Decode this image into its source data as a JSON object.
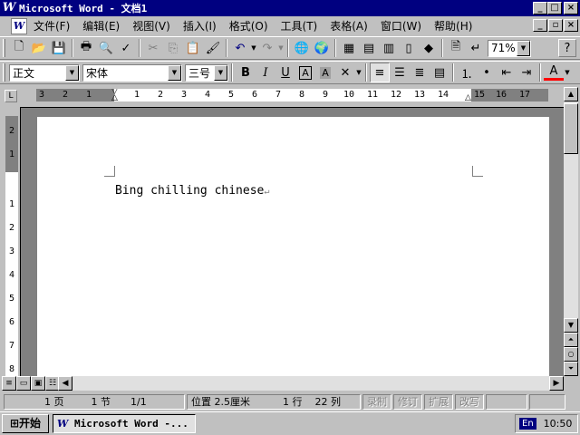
{
  "window": {
    "title": "Microsoft Word - 文档1",
    "app_icon": "W",
    "controls": [
      "_",
      "□",
      "×"
    ]
  },
  "menu": {
    "items": [
      "文件(F)",
      "编辑(E)",
      "视图(V)",
      "插入(I)",
      "格式(O)",
      "工具(T)",
      "表格(A)",
      "窗口(W)",
      "帮助(H)"
    ],
    "doc_controls": [
      "_",
      "▫",
      "×"
    ]
  },
  "standard_toolbar": {
    "zoom": "71%",
    "help": "?"
  },
  "format_toolbar": {
    "style": "正文",
    "font": "宋体",
    "size": "三号",
    "bold": "B",
    "italic": "I",
    "underline": "U",
    "font_color_label": "A"
  },
  "ruler": {
    "left_numbers": [
      "3",
      "2",
      "1"
    ],
    "right_numbers": [
      "1",
      "2",
      "3",
      "4",
      "5",
      "6",
      "7",
      "8",
      "9",
      "10",
      "11",
      "12",
      "13",
      "14",
      "15",
      "16",
      "17"
    ]
  },
  "vruler": {
    "top_numbers": [
      "2",
      "1"
    ],
    "numbers": [
      "1",
      "2",
      "3",
      "4",
      "5",
      "6",
      "7",
      "8"
    ]
  },
  "document": {
    "text": "Bing chilling chinese",
    "paragraph_mark": "↵"
  },
  "statusbar": {
    "page": "1 页",
    "section": "1 节",
    "page_of": "1/1",
    "position": "位置 2.5厘米",
    "line": "1 行",
    "column": "22 列",
    "rec": "录制",
    "trk": "修订",
    "ext": "扩展",
    "ovr": "改写"
  },
  "taskbar": {
    "start": "开始",
    "task": "Microsoft Word -...",
    "lang": "En",
    "clock": "10:50"
  }
}
